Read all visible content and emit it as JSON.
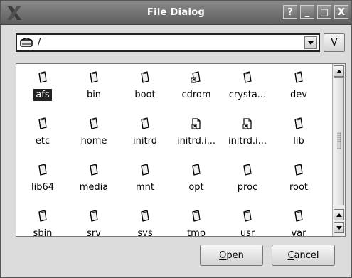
{
  "window": {
    "title": "File Dialog",
    "buttons": {
      "help": "?",
      "minimize": "_",
      "maximize": "□",
      "close": "X"
    }
  },
  "path": {
    "value": "/",
    "view_button": "V"
  },
  "files": [
    {
      "name": "afs",
      "type": "folder",
      "selected": true
    },
    {
      "name": "bin",
      "type": "folder"
    },
    {
      "name": "boot",
      "type": "folder"
    },
    {
      "name": "cdrom",
      "type": "folder-link"
    },
    {
      "name": "crysta...",
      "type": "folder"
    },
    {
      "name": "dev",
      "type": "folder"
    },
    {
      "name": "etc",
      "type": "folder"
    },
    {
      "name": "home",
      "type": "folder"
    },
    {
      "name": "initrd",
      "type": "folder"
    },
    {
      "name": "initrd.i...",
      "type": "file-link"
    },
    {
      "name": "initrd.i...",
      "type": "file-link"
    },
    {
      "name": "lib",
      "type": "folder"
    },
    {
      "name": "lib64",
      "type": "folder"
    },
    {
      "name": "media",
      "type": "folder"
    },
    {
      "name": "mnt",
      "type": "folder"
    },
    {
      "name": "opt",
      "type": "folder"
    },
    {
      "name": "proc",
      "type": "folder"
    },
    {
      "name": "root",
      "type": "folder"
    },
    {
      "name": "sbin",
      "type": "folder"
    },
    {
      "name": "srv",
      "type": "folder"
    },
    {
      "name": "sys",
      "type": "folder"
    },
    {
      "name": "tmp",
      "type": "folder"
    },
    {
      "name": "usr",
      "type": "folder"
    },
    {
      "name": "var",
      "type": "folder"
    }
  ],
  "actions": {
    "open_mnemonic": "O",
    "open_rest": "pen",
    "cancel_mnemonic": "C",
    "cancel_rest": "ancel"
  }
}
